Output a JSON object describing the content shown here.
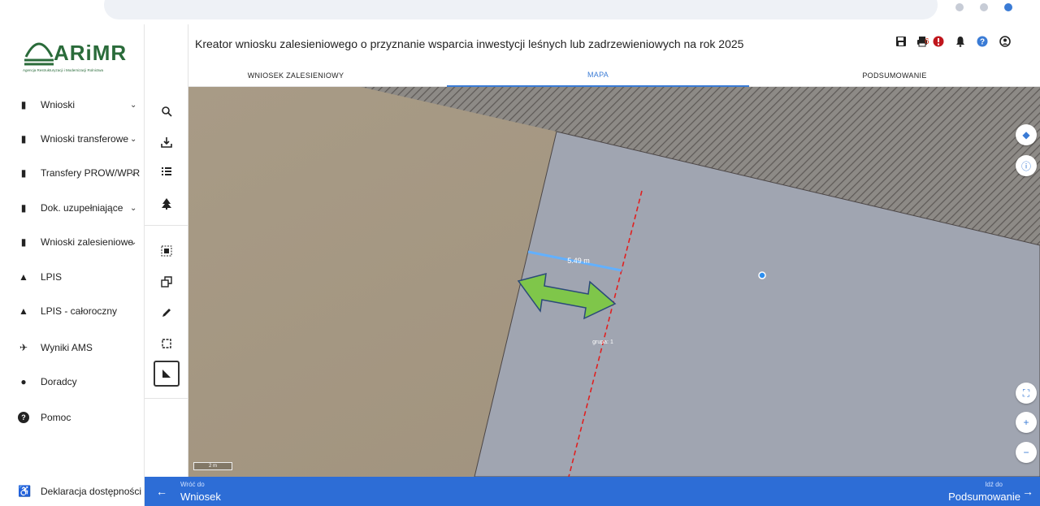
{
  "app": {
    "logo_text": "ARiMR",
    "logo_subtitle": "Agencja Restrukturyzacji i Modernizacji Rolnictwa",
    "title": "Kreator wniosku zalesieniowego o przyznanie wsparcia inwestycji leśnych lub zadrzewieniowych na rok 2025",
    "notification_count": "6"
  },
  "sidebar": {
    "items": [
      {
        "label": "Wnioski",
        "icon": "clipboard-icon",
        "has_chevron": true
      },
      {
        "label": "Wnioski transferowe",
        "icon": "clipboard-icon",
        "has_chevron": true
      },
      {
        "label": "Transfery PROW/WPR",
        "icon": "clipboard-icon",
        "has_chevron": true
      },
      {
        "label": "Dok. uzupełniające",
        "icon": "clipboard-icon",
        "has_chevron": true
      },
      {
        "label": "Wnioski zalesieniowe",
        "icon": "clipboard-icon",
        "has_chevron": true
      },
      {
        "label": "LPIS",
        "icon": "terrain-icon",
        "has_chevron": false
      },
      {
        "label": "LPIS - całoroczny",
        "icon": "terrain-icon",
        "has_chevron": false
      },
      {
        "label": "Wyniki AMS",
        "icon": "satellite-icon",
        "has_chevron": false
      },
      {
        "label": "Doradcy",
        "icon": "person-icon",
        "has_chevron": false
      },
      {
        "label": "Pomoc",
        "icon": "help-icon",
        "has_chevron": false
      }
    ],
    "accessibility": "Deklaracja dostępności"
  },
  "tabs": [
    {
      "label": "WNIOSEK ZALESIENIOWY",
      "active": false
    },
    {
      "label": "MAPA",
      "active": true
    },
    {
      "label": "PODSUMOWANIE",
      "active": false
    }
  ],
  "map": {
    "measure_label": "5.49 m",
    "group_label": "grupa: 1",
    "scale_label": "2 m",
    "colors": {
      "field": "#a69985",
      "parcel": "#9ea3ae",
      "hatch": "#6f6a66",
      "measure": "#62b0ff",
      "dashed": "#e02020",
      "arrow": "#7fc64a"
    }
  },
  "footer": {
    "back_small": "Wróć do",
    "back_big": "Wniosek",
    "next_small": "Idź do",
    "next_big": "Podsumowanie"
  }
}
